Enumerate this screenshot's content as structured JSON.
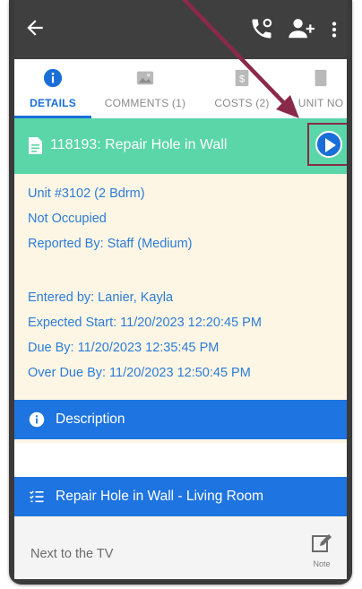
{
  "appbar": {
    "back_icon": "arrow-left-icon",
    "call_icon": "phone-call-icon",
    "add_user_icon": "person-add-icon",
    "more_icon": "more-vertical-icon"
  },
  "tabs": [
    {
      "label": "DETAILS",
      "icon": "info-icon",
      "active": true
    },
    {
      "label": "COMMENTS (1)",
      "icon": "image-icon",
      "active": false
    },
    {
      "label": "COSTS (2)",
      "icon": "receipt-icon",
      "active": false
    },
    {
      "label": "UNIT NO",
      "icon": "document-icon",
      "active": false
    }
  ],
  "work_order": {
    "title": "118193: Repair Hole in Wall",
    "doc_icon": "document-icon",
    "play_icon": "play-icon"
  },
  "details": {
    "unit": "Unit #3102 (2 Bdrm)",
    "occupancy": "Not Occupied",
    "reported_by": "Reported By: Staff  (Medium)",
    "entered_by": "Entered by: Lanier, Kayla",
    "expected_start": "Expected Start: 11/20/2023 12:20:45 PM",
    "due_by": "Due By: 11/20/2023 12:35:45 PM",
    "over_due_by": "Over Due By: 11/20/2023 12:50:45 PM"
  },
  "description_section": {
    "label": "Description",
    "icon": "info-icon"
  },
  "task_section": {
    "label": "Repair Hole in Wall - Living Room",
    "icon": "checklist-icon"
  },
  "note": {
    "text": "Next to the TV",
    "button_label": "Note",
    "icon": "edit-note-icon"
  },
  "colors": {
    "appbar": "#3f3f3f",
    "accent": "#1a6ed8",
    "titlebar": "#5ad6a8",
    "section": "#1e74e0",
    "detail_text": "#2d7cd8",
    "background": "#fdf6e4",
    "annotation": "#8a2a4a"
  }
}
